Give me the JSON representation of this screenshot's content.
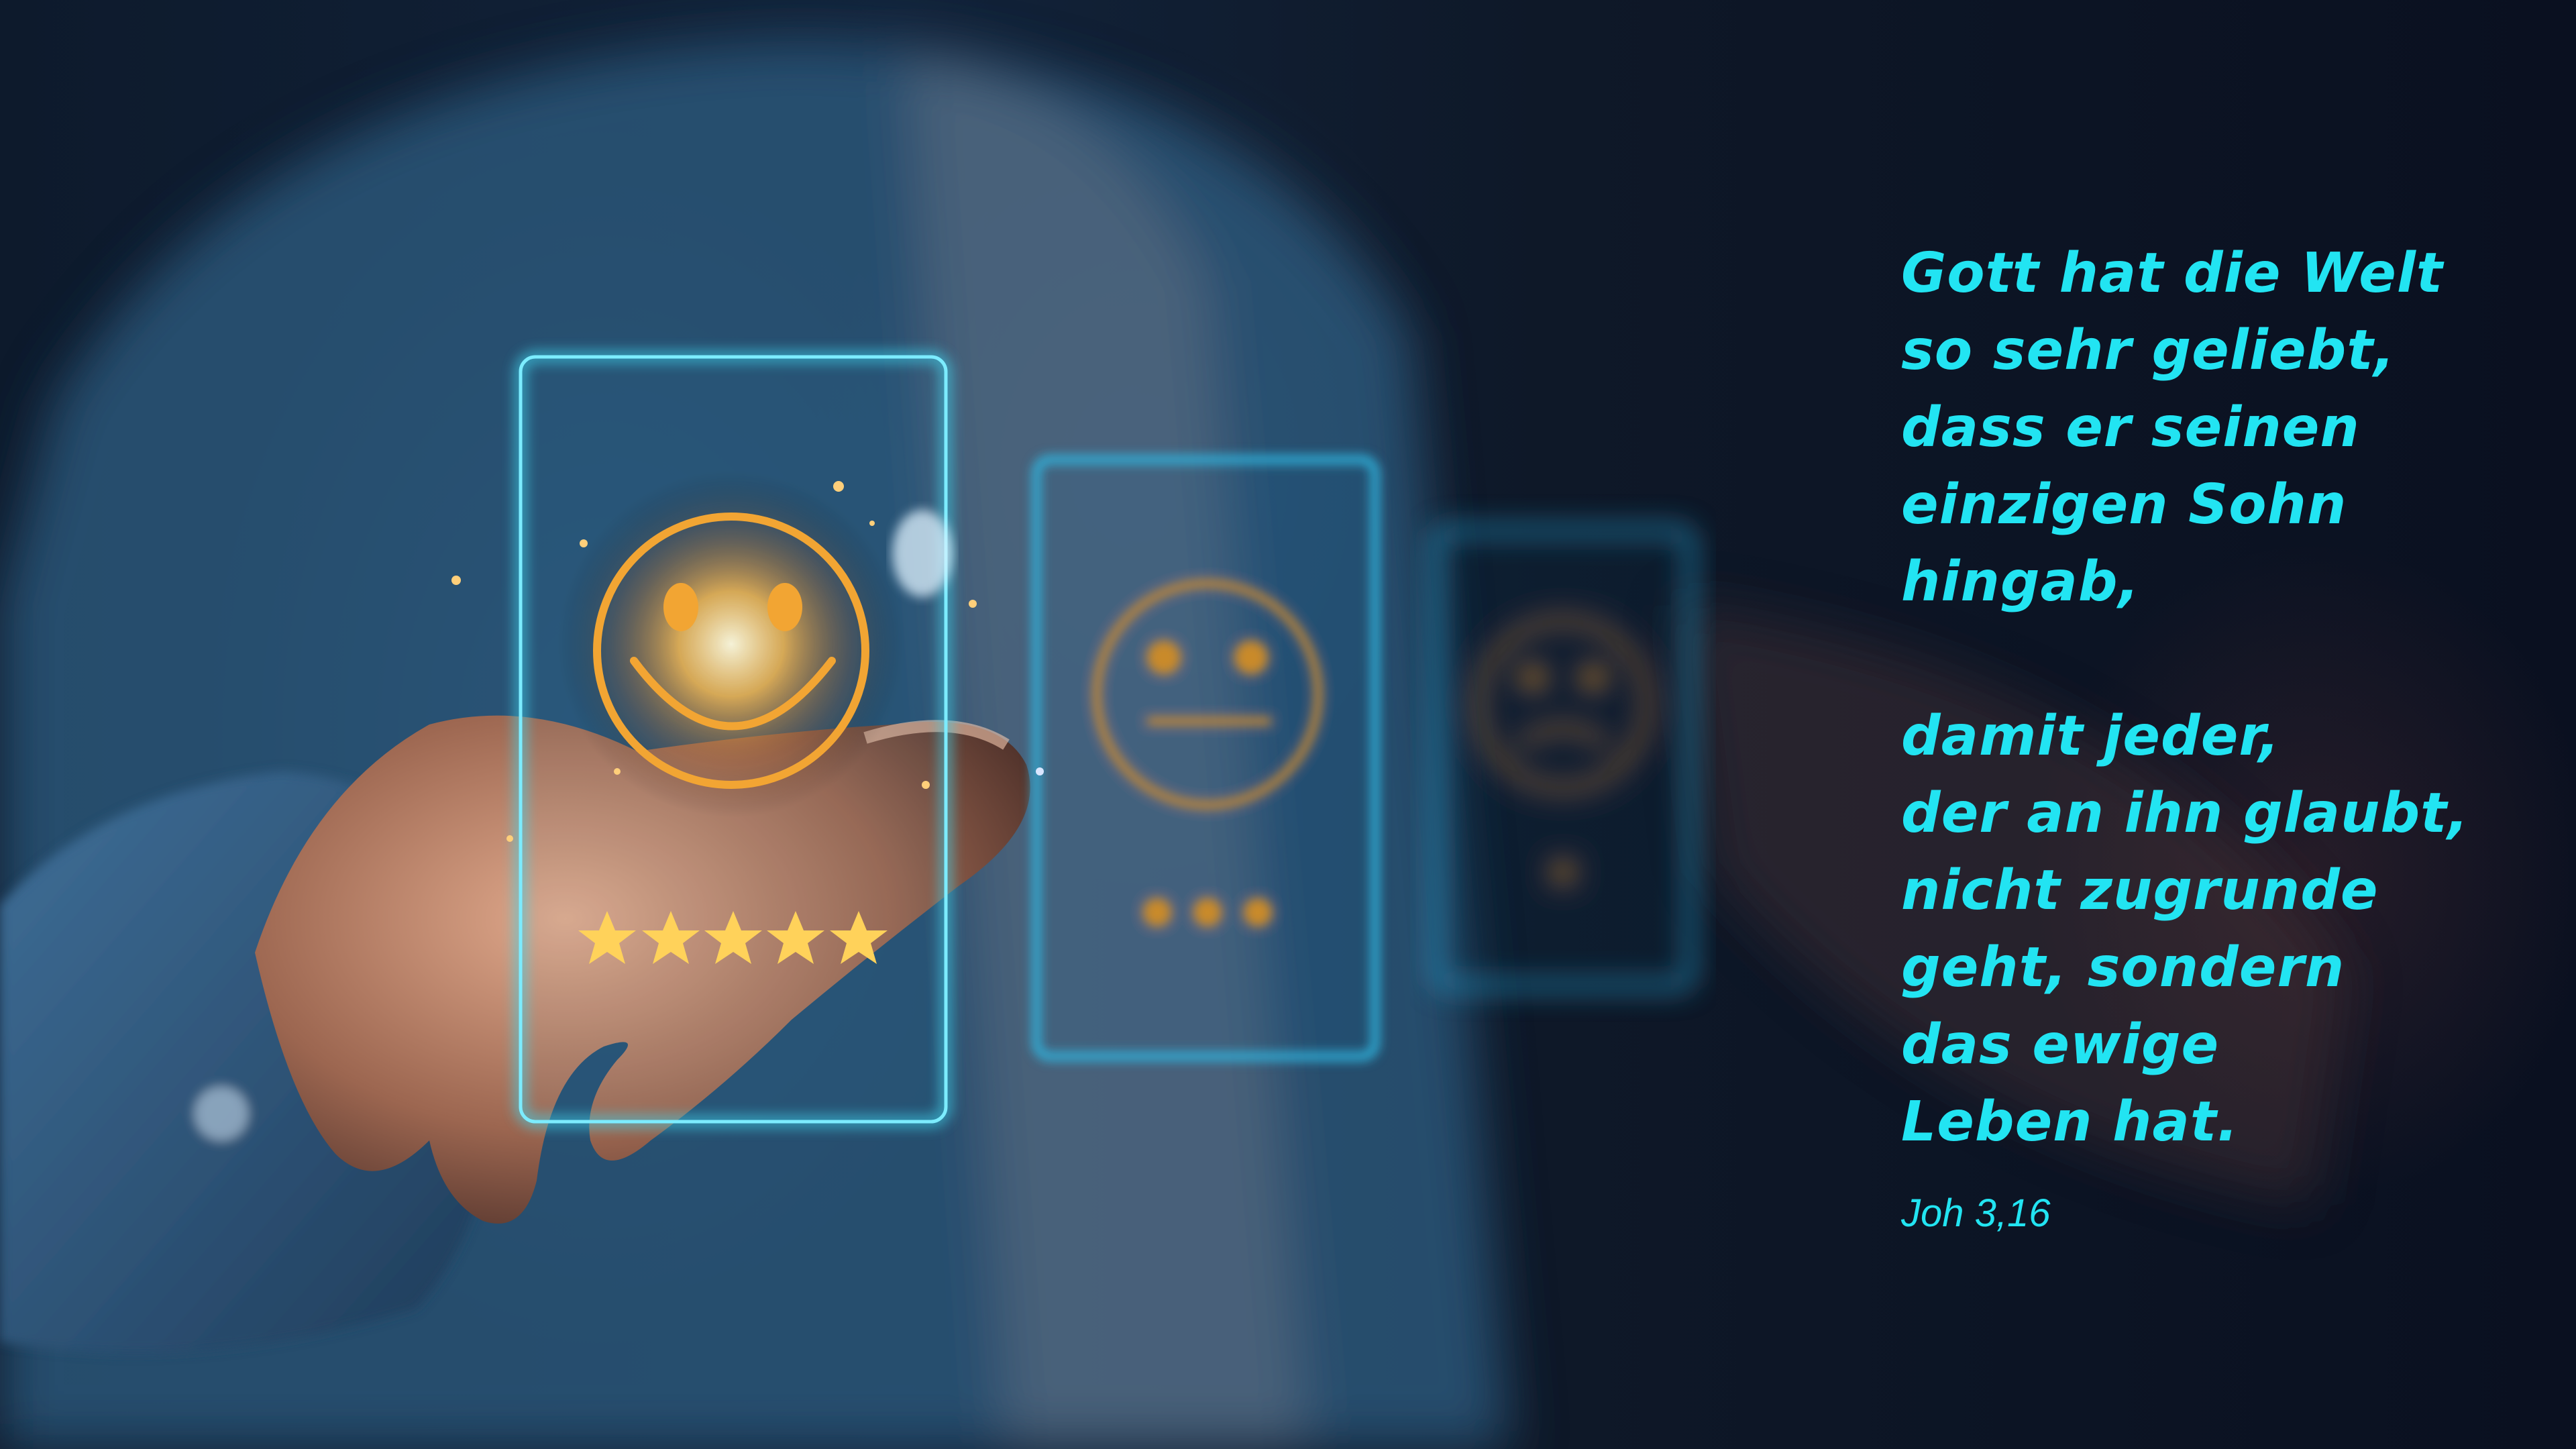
{
  "verse_lines_part1": [
    "Gott hat die Welt",
    "so sehr geliebt,",
    "dass er seinen",
    "einzigen Sohn",
    "hingab,"
  ],
  "verse_lines_part2": [
    "damit jeder,",
    "der an ihn glaubt,",
    "nicht zugrunde",
    "geht, sondern",
    "das ewige",
    "Leben hat."
  ],
  "reference": "Joh 3,16",
  "colors": {
    "text_accent": "#22e4f2",
    "card_border": "#3fd8f0",
    "emoji": "#f2a533",
    "star": "#ffd25a"
  },
  "rating_cards": [
    {
      "icon": "smiley-happy-icon",
      "stars": 5
    },
    {
      "icon": "smiley-neutral-icon",
      "stars": 3
    },
    {
      "icon": "smiley-sad-icon",
      "stars": 1
    }
  ]
}
